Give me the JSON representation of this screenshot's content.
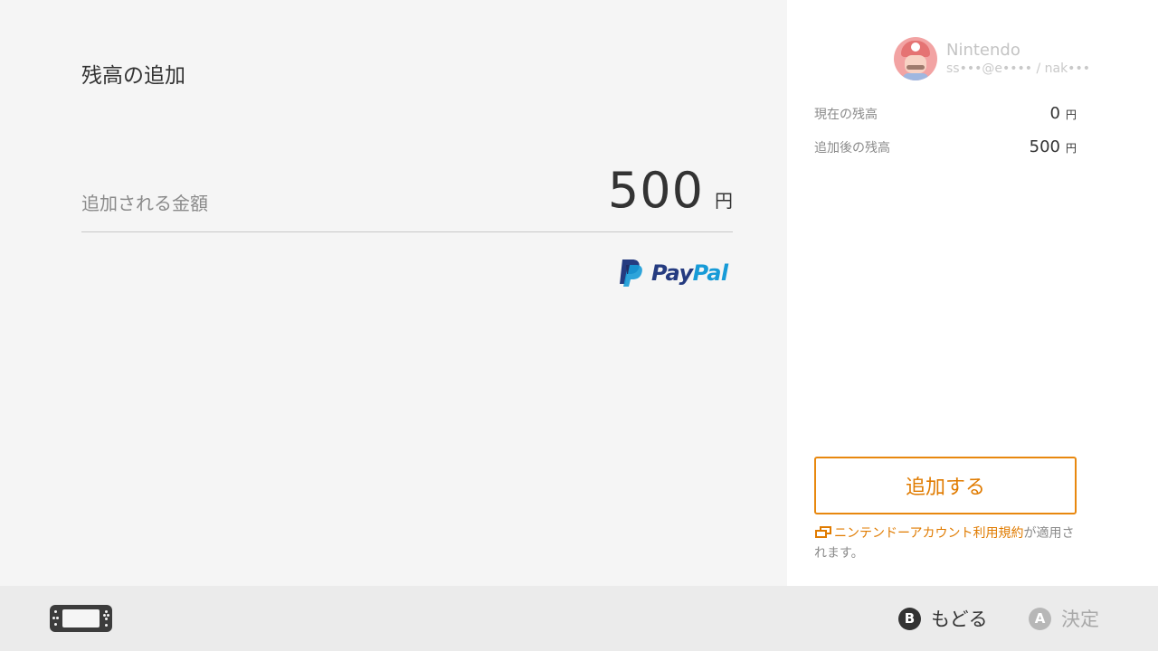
{
  "main": {
    "title": "残高の追加",
    "amount_label": "追加される金額",
    "amount_value": "500",
    "amount_unit": "円",
    "payment_method": {
      "pay": "Pay",
      "pal": "Pal"
    }
  },
  "account": {
    "name": "Nintendo",
    "id": "ss•••@e•••• / nak•••"
  },
  "balance": {
    "current_label": "現在の残高",
    "current_value": "0",
    "after_label": "追加後の残高",
    "after_value": "500",
    "unit": "円"
  },
  "add_button_label": "追加する",
  "terms": {
    "link_text": "ニンテンドーアカウント利用規約",
    "suffix": "が適用されます。"
  },
  "footer": {
    "back_key": "B",
    "back_label": "もどる",
    "confirm_key": "A",
    "confirm_label": "決定"
  },
  "colors": {
    "accent": "#e07b00",
    "paypal_dark": "#253b80",
    "paypal_light": "#179bd7"
  }
}
